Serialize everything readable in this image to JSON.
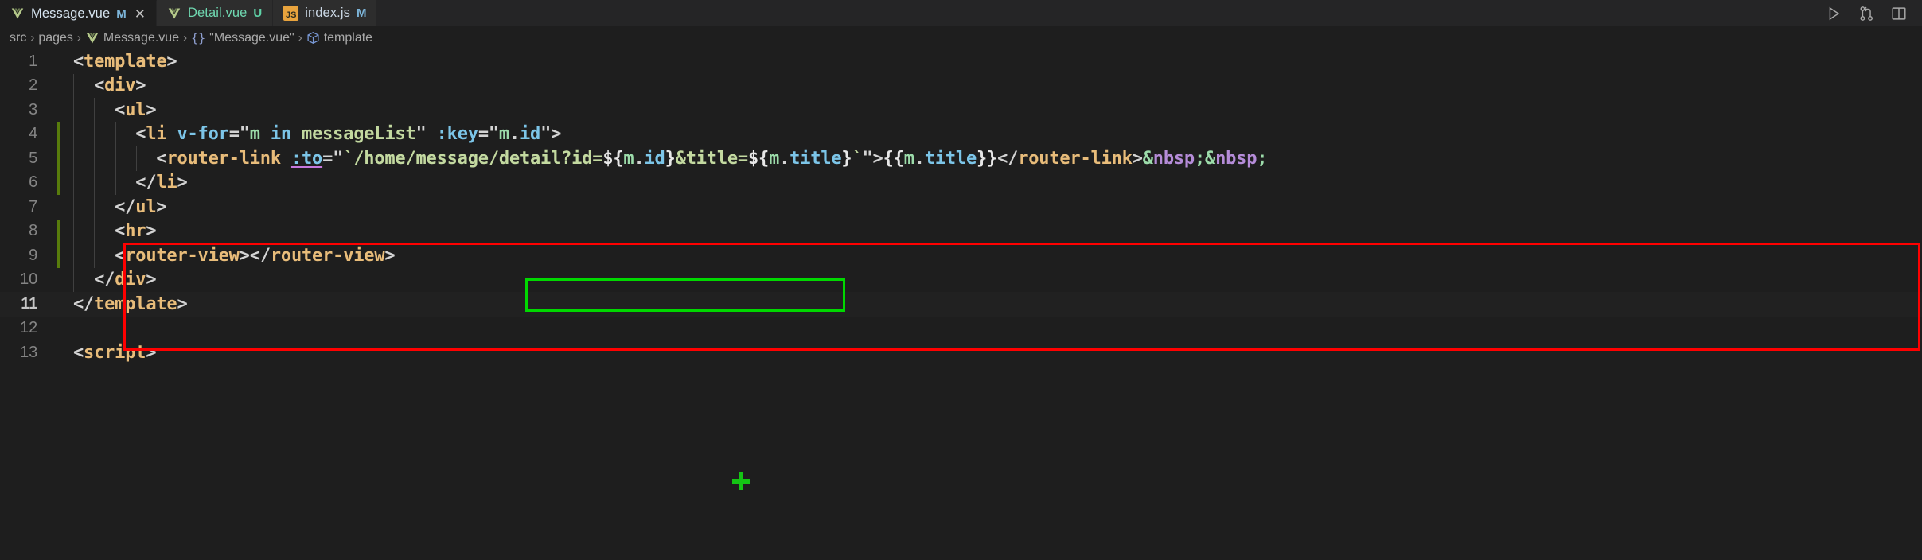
{
  "tabs": [
    {
      "label": "Message.vue",
      "badge": "M",
      "badge_color": "#7cb4d8",
      "label_color": "#d6e4f0",
      "icon": "vue-icon",
      "active": true,
      "closable": true
    },
    {
      "label": "Detail.vue",
      "badge": "U",
      "badge_color": "#5fd3a8",
      "label_color": "#6fd7b0",
      "icon": "vue-icon",
      "active": false,
      "closable": false
    },
    {
      "label": "index.js",
      "badge": "M",
      "badge_color": "#7cb4d8",
      "label_color": "#c9d6e3",
      "icon": "js-icon",
      "active": false,
      "closable": false
    }
  ],
  "tabbar_actions": [
    {
      "name": "run-button",
      "label": "Run"
    },
    {
      "name": "split-diff-button",
      "label": "Compare Changes"
    },
    {
      "name": "split-editor-button",
      "label": "Split Editor Right"
    }
  ],
  "breadcrumb": {
    "items": [
      {
        "label": "src",
        "icon": null
      },
      {
        "label": "pages",
        "icon": null
      },
      {
        "label": "Message.vue",
        "icon": "vue-icon"
      },
      {
        "label": "\"Message.vue\"",
        "icon": "braces"
      },
      {
        "label": "template",
        "icon": "symbol-module"
      }
    ],
    "separator": "›"
  },
  "editor": {
    "current_line": 11,
    "lines": [
      {
        "n": "1",
        "indent": 0,
        "git": false,
        "tokens": [
          {
            "c": "t-punct",
            "t": "<"
          },
          {
            "c": "t-tag",
            "t": "template"
          },
          {
            "c": "t-punct",
            "t": ">"
          }
        ]
      },
      {
        "n": "2",
        "indent": 1,
        "git": false,
        "tokens": [
          {
            "c": "t-punct",
            "t": "  <"
          },
          {
            "c": "t-tag",
            "t": "div"
          },
          {
            "c": "t-punct",
            "t": ">"
          }
        ]
      },
      {
        "n": "3",
        "indent": 2,
        "git": false,
        "tokens": [
          {
            "c": "t-punct",
            "t": "    <"
          },
          {
            "c": "t-tag",
            "t": "ul"
          },
          {
            "c": "t-punct",
            "t": ">"
          }
        ]
      },
      {
        "n": "4",
        "indent": 3,
        "git": true,
        "tokens": [
          {
            "c": "t-punct",
            "t": "      <"
          },
          {
            "c": "t-tag",
            "t": "li"
          },
          {
            "c": "t-punct",
            "t": " "
          },
          {
            "c": "t-attr",
            "t": "v-for"
          },
          {
            "c": "t-eq",
            "t": "="
          },
          {
            "c": "t-punct",
            "t": "\""
          },
          {
            "c": "t-obj",
            "t": "m"
          },
          {
            "c": "t-punct",
            "t": " "
          },
          {
            "c": "t-attr",
            "t": "in"
          },
          {
            "c": "t-punct",
            "t": " "
          },
          {
            "c": "t-str",
            "t": "messageList"
          },
          {
            "c": "t-punct",
            "t": "\""
          },
          {
            "c": "t-punct",
            "t": " "
          },
          {
            "c": "t-attr",
            "t": ":key"
          },
          {
            "c": "t-eq",
            "t": "="
          },
          {
            "c": "t-punct",
            "t": "\""
          },
          {
            "c": "t-obj",
            "t": "m"
          },
          {
            "c": "t-punct",
            "t": "."
          },
          {
            "c": "t-prop",
            "t": "id"
          },
          {
            "c": "t-punct",
            "t": "\">"
          }
        ]
      },
      {
        "n": "5",
        "indent": 4,
        "git": true,
        "tokens": [
          {
            "c": "t-punct",
            "t": "        <"
          },
          {
            "c": "t-tag",
            "t": "router-link"
          },
          {
            "c": "t-punct",
            "t": " "
          },
          {
            "c": "t-attr squiggle",
            "t": ":to"
          },
          {
            "c": "t-eq",
            "t": "="
          },
          {
            "c": "t-punct",
            "t": "\""
          },
          {
            "c": "t-str",
            "t": "`/home/message/detail?id="
          },
          {
            "c": "t-interp",
            "t": "${"
          },
          {
            "c": "t-obj",
            "t": "m"
          },
          {
            "c": "t-punct",
            "t": "."
          },
          {
            "c": "t-prop",
            "t": "id"
          },
          {
            "c": "t-interp",
            "t": "}"
          },
          {
            "c": "t-str",
            "t": "&title="
          },
          {
            "c": "t-interp",
            "t": "${"
          },
          {
            "c": "t-obj",
            "t": "m"
          },
          {
            "c": "t-punct",
            "t": "."
          },
          {
            "c": "t-prop",
            "t": "title"
          },
          {
            "c": "t-interp",
            "t": "}"
          },
          {
            "c": "t-str",
            "t": "`"
          },
          {
            "c": "t-punct",
            "t": "\">"
          },
          {
            "c": "t-interp",
            "t": "{{"
          },
          {
            "c": "t-obj",
            "t": "m"
          },
          {
            "c": "t-punct",
            "t": "."
          },
          {
            "c": "t-prop",
            "t": "title"
          },
          {
            "c": "t-interp",
            "t": "}}"
          },
          {
            "c": "t-punct",
            "t": "</"
          },
          {
            "c": "t-tag",
            "t": "router-link"
          },
          {
            "c": "t-punct",
            "t": ">"
          },
          {
            "c": "t-entity",
            "t": "&"
          },
          {
            "c": "t-entity-name",
            "t": "nbsp"
          },
          {
            "c": "t-entity",
            "t": ";"
          },
          {
            "c": "t-entity",
            "t": "&"
          },
          {
            "c": "t-entity-name",
            "t": "nbsp"
          },
          {
            "c": "t-entity",
            "t": ";"
          }
        ]
      },
      {
        "n": "6",
        "indent": 3,
        "git": true,
        "tokens": [
          {
            "c": "t-punct",
            "t": "      </"
          },
          {
            "c": "t-tag",
            "t": "li"
          },
          {
            "c": "t-punct",
            "t": ">"
          }
        ]
      },
      {
        "n": "7",
        "indent": 2,
        "git": false,
        "tokens": [
          {
            "c": "t-punct",
            "t": "    </"
          },
          {
            "c": "t-tag",
            "t": "ul"
          },
          {
            "c": "t-punct",
            "t": ">"
          }
        ]
      },
      {
        "n": "8",
        "indent": 2,
        "git": true,
        "tokens": [
          {
            "c": "t-punct",
            "t": "    <"
          },
          {
            "c": "t-tag",
            "t": "hr"
          },
          {
            "c": "t-punct",
            "t": ">"
          }
        ]
      },
      {
        "n": "9",
        "indent": 2,
        "git": true,
        "tokens": [
          {
            "c": "t-punct",
            "t": "    <"
          },
          {
            "c": "t-tag",
            "t": "router-view"
          },
          {
            "c": "t-punct",
            "t": "></"
          },
          {
            "c": "t-tag",
            "t": "router-view"
          },
          {
            "c": "t-punct",
            "t": ">"
          }
        ]
      },
      {
        "n": "10",
        "indent": 1,
        "git": false,
        "tokens": [
          {
            "c": "t-punct",
            "t": "  </"
          },
          {
            "c": "t-tag",
            "t": "div"
          },
          {
            "c": "t-punct",
            "t": ">"
          }
        ]
      },
      {
        "n": "11",
        "indent": 0,
        "git": false,
        "current": true,
        "tokens": [
          {
            "c": "t-punct",
            "t": "</"
          },
          {
            "c": "t-tag",
            "t": "template"
          },
          {
            "c": "t-punct",
            "t": ">"
          }
        ]
      },
      {
        "n": "12",
        "indent": 0,
        "git": false,
        "tokens": []
      },
      {
        "n": "13",
        "indent": 0,
        "git": false,
        "tokens": [
          {
            "c": "t-punct",
            "t": "<"
          },
          {
            "c": "t-tag",
            "t": "script"
          },
          {
            "c": "t-punct",
            "t": ">"
          }
        ]
      }
    ]
  },
  "annotations": {
    "red_box_label": "highlighted-li-block",
    "green_box_label": "highlighted-template-literal",
    "plus_marker_label": "green-plus-cursor-marker"
  },
  "colors": {
    "editor_bg": "#1e1e1e",
    "tabbar_bg": "#252526",
    "tab_inactive_bg": "#2d2d2d",
    "annotation_red": "#ff0000",
    "annotation_green": "#00d800",
    "git_added": "#587c0c"
  }
}
